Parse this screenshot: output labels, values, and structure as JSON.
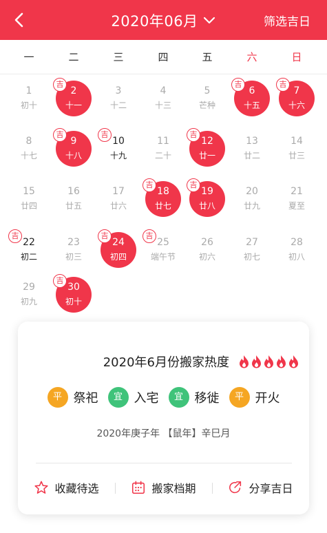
{
  "header": {
    "title": "2020年06月",
    "filter_label": "筛选吉日",
    "bg_color": "#f0364a"
  },
  "weekdays": [
    "一",
    "二",
    "三",
    "四",
    "五",
    "六",
    "日"
  ],
  "calendar": {
    "lucky_mark": "吉",
    "days": [
      {
        "day": "1",
        "lunar": "初十",
        "col": 0,
        "row": 0
      },
      {
        "day": "2",
        "lunar": "十一",
        "col": 1,
        "row": 0,
        "lucky": true
      },
      {
        "day": "3",
        "lunar": "十二",
        "col": 2,
        "row": 0
      },
      {
        "day": "4",
        "lunar": "十三",
        "col": 3,
        "row": 0
      },
      {
        "day": "5",
        "lunar": "芒种",
        "col": 4,
        "row": 0
      },
      {
        "day": "6",
        "lunar": "十五",
        "col": 5,
        "row": 0,
        "lucky": true
      },
      {
        "day": "7",
        "lunar": "十六",
        "col": 6,
        "row": 0,
        "lucky": true
      },
      {
        "day": "8",
        "lunar": "十七",
        "col": 0,
        "row": 1
      },
      {
        "day": "9",
        "lunar": "十八",
        "col": 1,
        "row": 1,
        "lucky": true
      },
      {
        "day": "10",
        "lunar": "十九",
        "col": 2,
        "row": 1,
        "mark": true,
        "bold": true
      },
      {
        "day": "11",
        "lunar": "二十",
        "col": 3,
        "row": 1
      },
      {
        "day": "12",
        "lunar": "廿一",
        "col": 4,
        "row": 1,
        "lucky": true
      },
      {
        "day": "13",
        "lunar": "廿二",
        "col": 5,
        "row": 1
      },
      {
        "day": "14",
        "lunar": "廿三",
        "col": 6,
        "row": 1
      },
      {
        "day": "15",
        "lunar": "廿四",
        "col": 0,
        "row": 2
      },
      {
        "day": "16",
        "lunar": "廿五",
        "col": 1,
        "row": 2
      },
      {
        "day": "17",
        "lunar": "廿六",
        "col": 2,
        "row": 2
      },
      {
        "day": "18",
        "lunar": "廿七",
        "col": 3,
        "row": 2,
        "lucky": true
      },
      {
        "day": "19",
        "lunar": "廿八",
        "col": 4,
        "row": 2,
        "lucky": true
      },
      {
        "day": "20",
        "lunar": "廿九",
        "col": 5,
        "row": 2
      },
      {
        "day": "21",
        "lunar": "夏至",
        "col": 6,
        "row": 2
      },
      {
        "day": "22",
        "lunar": "初二",
        "col": 0,
        "row": 3,
        "mark": true,
        "bold": true
      },
      {
        "day": "23",
        "lunar": "初三",
        "col": 1,
        "row": 3
      },
      {
        "day": "24",
        "lunar": "初四",
        "col": 2,
        "row": 3,
        "lucky": true
      },
      {
        "day": "25",
        "lunar": "端午节",
        "col": 3,
        "row": 3,
        "mark": true
      },
      {
        "day": "26",
        "lunar": "初六",
        "col": 4,
        "row": 3
      },
      {
        "day": "27",
        "lunar": "初七",
        "col": 5,
        "row": 3
      },
      {
        "day": "28",
        "lunar": "初八",
        "col": 6,
        "row": 3
      },
      {
        "day": "29",
        "lunar": "初九",
        "col": 0,
        "row": 4
      },
      {
        "day": "30",
        "lunar": "初十",
        "col": 1,
        "row": 4,
        "lucky": true
      }
    ]
  },
  "card": {
    "heat_label": "2020年6月份搬家热度",
    "heat_level": 5,
    "heat_max": 5,
    "tags": [
      {
        "badge": "平",
        "label": "祭祀",
        "color": "#f5a623"
      },
      {
        "badge": "宜",
        "label": "入宅",
        "color": "#3fc37a"
      },
      {
        "badge": "宜",
        "label": "移徙",
        "color": "#3fc37a"
      },
      {
        "badge": "平",
        "label": "开火",
        "color": "#f5a623"
      }
    ],
    "year_line": "2020年庚子年 【鼠年】辛巳月",
    "actions": [
      {
        "label": "收藏待选",
        "icon": "star-icon"
      },
      {
        "label": "搬家档期",
        "icon": "calendar-icon"
      },
      {
        "label": "分享吉日",
        "icon": "share-icon"
      }
    ]
  },
  "colors": {
    "accent": "#f0364a",
    "text_muted": "#aaaaaa",
    "text_dark": "#222222"
  }
}
